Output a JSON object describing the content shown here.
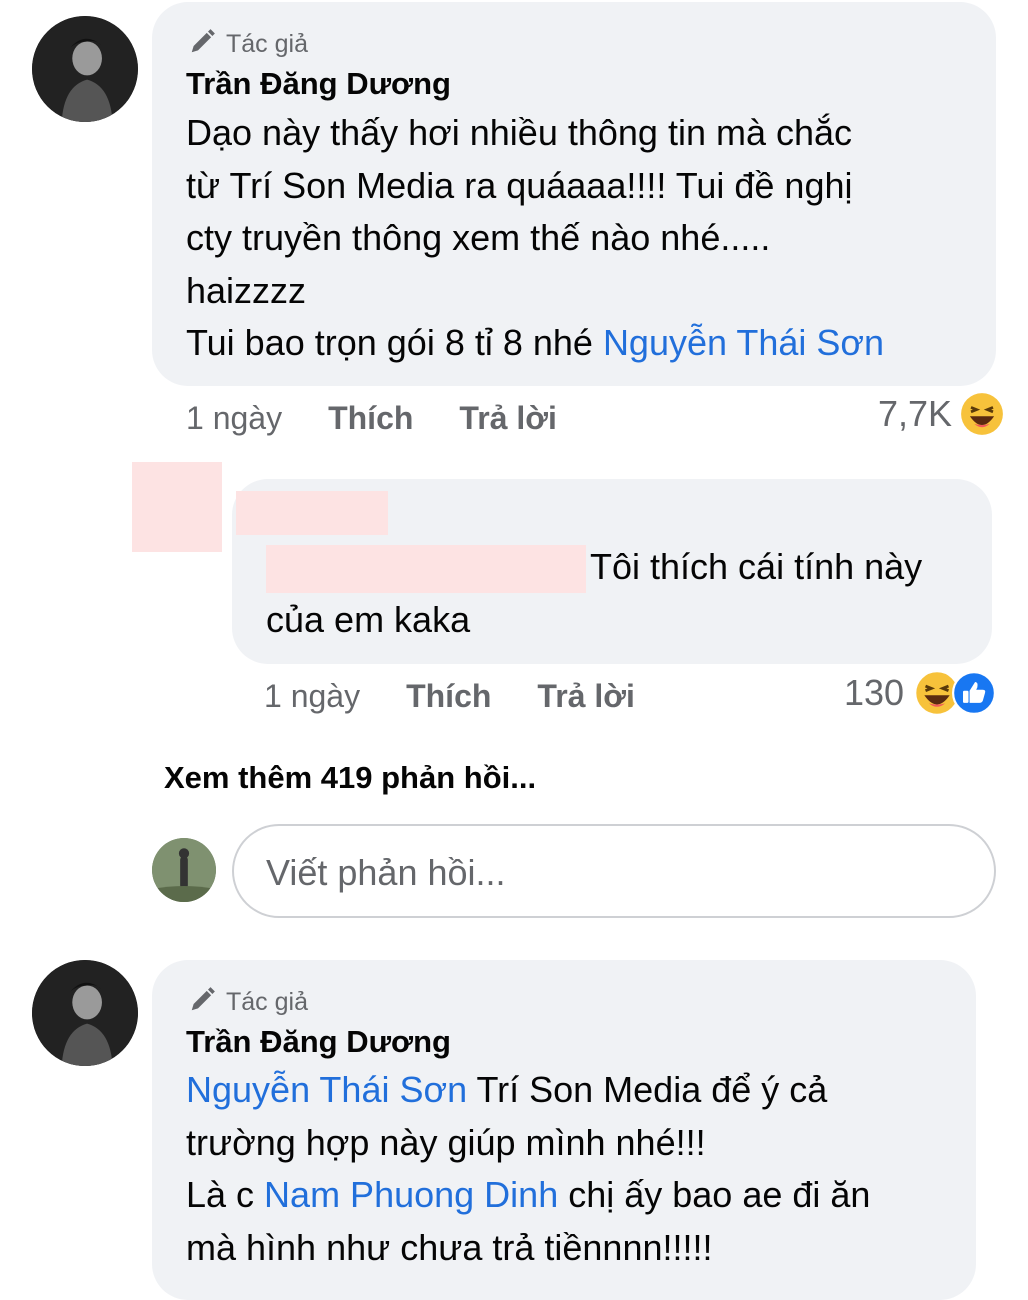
{
  "comment1": {
    "badge": "Tác giả",
    "author": "Trần Đăng Dương",
    "lines": [
      "Dạo này thấy hơi nhiều thông tin mà chắc",
      "từ Trí Son Media ra quáaaa!!!! Tui đề nghị",
      "cty truyền thông xem thế nào nhé.....",
      "haizzzz"
    ],
    "last_line_text": "Tui bao trọn gói 8 tỉ 8 nhé ",
    "last_line_mention": "Nguyễn Thái Sơn",
    "time": "1 ngày",
    "like": "Thích",
    "reply": "Trả lời",
    "reaction_count": "7,7K",
    "reaction_icon": "haha-emoji"
  },
  "reply1": {
    "text_line1": "Tôi thích cái tính này",
    "text_line2": "của em kaka",
    "time": "1 ngày",
    "like": "Thích",
    "reply": "Trả lời",
    "reaction_count": "130",
    "reaction_icons": [
      "haha-emoji",
      "like-emoji"
    ]
  },
  "more_replies": "Xem thêm 419 phản hồi...",
  "reply_input": {
    "placeholder": "Viết phản hồi..."
  },
  "comment2": {
    "badge": "Tác giả",
    "author": "Trần Đăng Dương",
    "line1_mention": "Nguyễn Thái Sơn",
    "line1_text": " Trí Son Media để ý cả",
    "line2": "trường hợp này giúp mình nhé!!!",
    "line3_pre": "Là c ",
    "line3_mention": "Nam Phuong Dinh",
    "line3_post": " chị ấy bao ae đi ăn",
    "line4": "mà hình như chưa trả tiềnnnn!!!!!"
  },
  "colors": {
    "bubble": "#f0f2f5",
    "mention": "#216fdb",
    "meta": "#65676b",
    "redaction": "#fde3e3"
  }
}
